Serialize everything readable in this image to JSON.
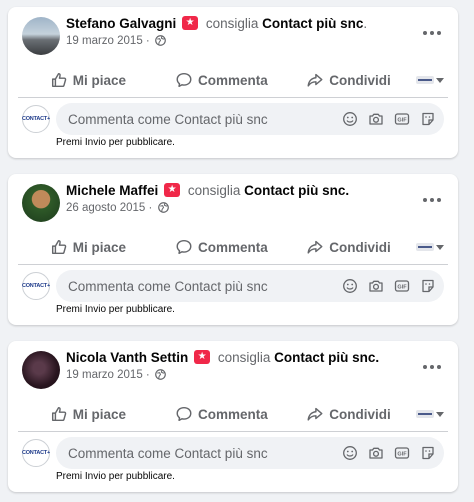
{
  "posts": [
    {
      "author": "Stefano Galvagni",
      "verb": "consiglia",
      "page": "Contact più snc",
      "page_suffix": ".",
      "date": "19 marzo 2015",
      "date_sep": "·",
      "avatar_icon": "user-photo-landscape"
    },
    {
      "author": "Michele Maffei",
      "verb": "consiglia",
      "page": "Contact più snc.",
      "page_suffix": "",
      "date": "26 agosto 2015",
      "date_sep": "·",
      "avatar_icon": "user-photo-portrait"
    },
    {
      "author": "Nicola Vanth Settin",
      "verb": "consiglia",
      "page": "Contact più snc.",
      "page_suffix": "",
      "date": "19 marzo 2015",
      "date_sep": "·",
      "avatar_icon": "user-photo-dark"
    }
  ],
  "actions": {
    "like": "Mi piace",
    "comment": "Commenta",
    "share": "Condividi"
  },
  "comment": {
    "placeholder": "Commenta come Contact più snc",
    "hint": "Premi Invio per pubblicare.",
    "logo_text": "CONTACT+",
    "gif_label": "GIF"
  },
  "colors": {
    "background": "#f0f2f5",
    "card": "#ffffff",
    "badge": "#f02849",
    "muted": "#65676b"
  },
  "icons": [
    "globe-icon",
    "more-icon",
    "like-icon",
    "comment-icon",
    "share-icon",
    "emoji-icon",
    "camera-icon",
    "gif-icon",
    "sticker-icon",
    "caret-down-icon"
  ]
}
